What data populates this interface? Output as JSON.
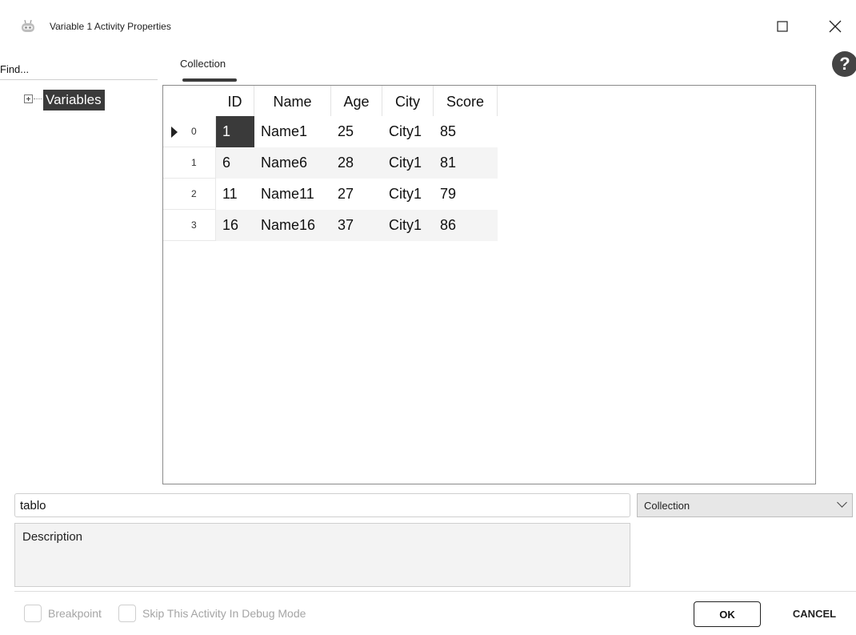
{
  "window": {
    "title": "Variable 1 Activity Properties",
    "app_icon": "robot-icon",
    "controls": {
      "maximize_icon": "maximize-icon",
      "close_icon": "close-icon"
    }
  },
  "left_panel": {
    "find_placeholder": "Find...",
    "tree_items": [
      {
        "label": "Variables",
        "expander": "+",
        "selected": true
      }
    ]
  },
  "tabs": [
    {
      "label": "Collection",
      "active": true
    }
  ],
  "help": {
    "icon": "help-icon",
    "label": "?"
  },
  "grid": {
    "columns": [
      "ID",
      "Name",
      "Age",
      "City",
      "Score"
    ],
    "rows": [
      {
        "index": "0",
        "current": true,
        "cells": [
          "1",
          "Name1",
          "25",
          "City1",
          "85"
        ]
      },
      {
        "index": "1",
        "current": false,
        "cells": [
          "6",
          "Name6",
          "28",
          "City1",
          "81"
        ]
      },
      {
        "index": "2",
        "current": false,
        "cells": [
          "11",
          "Name11",
          "27",
          "City1",
          "79"
        ]
      },
      {
        "index": "3",
        "current": false,
        "cells": [
          "16",
          "Name16",
          "37",
          "City1",
          "86"
        ]
      }
    ],
    "selected_cell": {
      "row": 0,
      "column": "ID"
    }
  },
  "variable_name": {
    "value": "tablo"
  },
  "variable_type": {
    "selected": "Collection"
  },
  "description": {
    "placeholder": "Description"
  },
  "bottom": {
    "breakpoint_label": "Breakpoint",
    "skip_debug_label": "Skip This Activity In Debug Mode",
    "ok_label": "OK",
    "cancel_label": "CANCEL"
  },
  "colors": {
    "selection": "#3a3a3a",
    "alt_row": "#f4f4f4",
    "disabled_text": "#a5a5a5"
  }
}
